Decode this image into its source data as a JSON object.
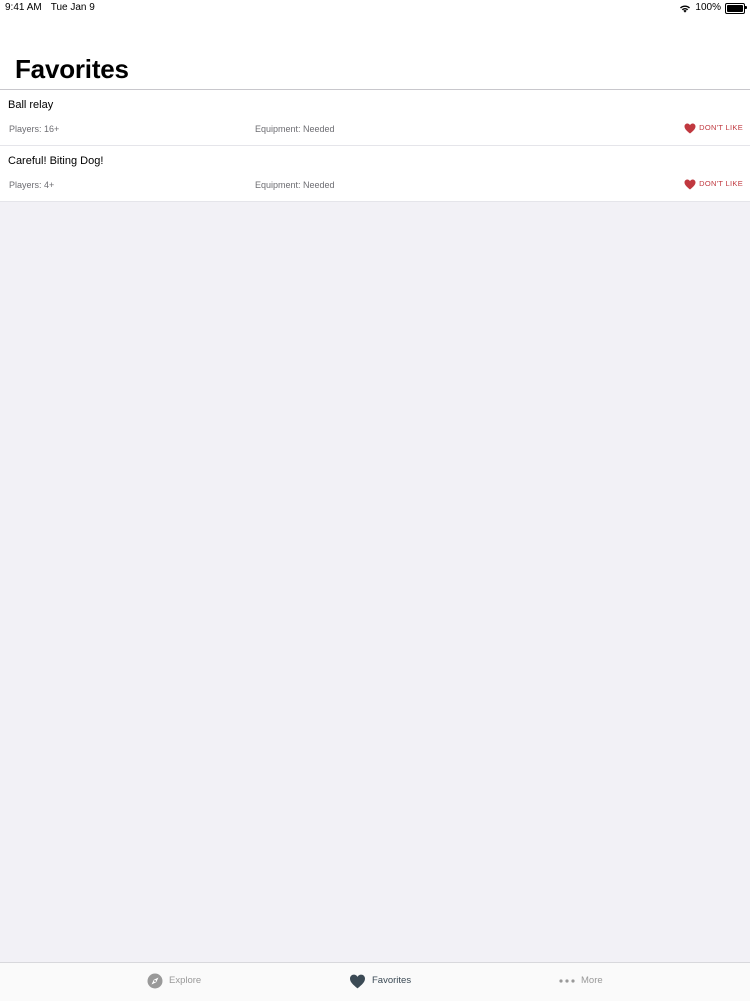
{
  "status_bar": {
    "time": "9:41 AM",
    "date": "Tue Jan 9",
    "battery": "100%"
  },
  "header": {
    "title": "Favorites"
  },
  "items": [
    {
      "title": "Ball relay",
      "players": "Players: 16+",
      "equipment": "Equipment: Needed",
      "action_label": "DON'T LIKE"
    },
    {
      "title": "Careful! Biting Dog!",
      "players": "Players: 4+",
      "equipment": "Equipment: Needed",
      "action_label": "DON'T LIKE"
    }
  ],
  "tab_bar": {
    "tabs": [
      {
        "label": "Explore",
        "icon": "compass-icon",
        "selected": false
      },
      {
        "label": "Favorites",
        "icon": "heart-icon",
        "selected": true
      },
      {
        "label": "More",
        "icon": "more-dots-icon",
        "selected": false
      }
    ]
  },
  "colors": {
    "accent_red": "#c0383f",
    "selected_tab": "#3b4a55",
    "unselected_tab": "#999999",
    "background": "#f2f1f6"
  }
}
